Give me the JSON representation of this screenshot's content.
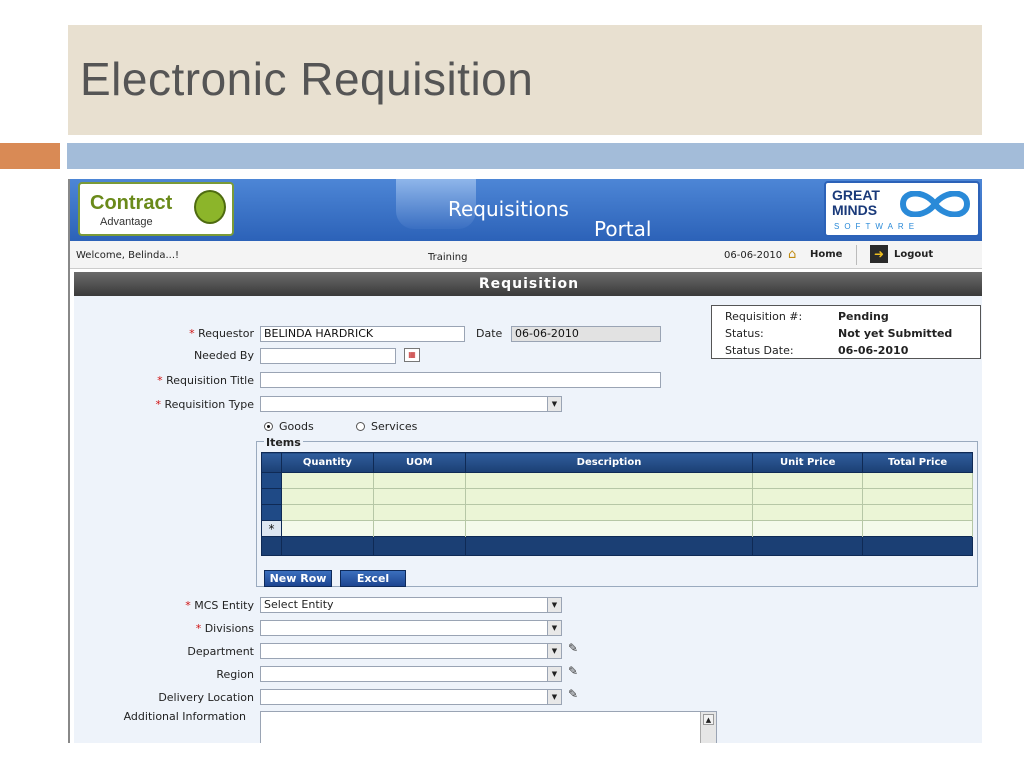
{
  "slide": {
    "title": "Electronic Requisition"
  },
  "banner": {
    "left_logo_main": "Contract",
    "left_logo_sub": "Advantage",
    "portal_word1": "Requisitions",
    "portal_word2": "Portal",
    "right_logo_line1": "GREAT",
    "right_logo_line2": "MINDS",
    "right_logo_line3": "SOFTWARE"
  },
  "infobar": {
    "welcome": "Welcome, Belinda...!",
    "environment": "Training",
    "date": "06-06-2010",
    "home_label": "Home",
    "logout_label": "Logout"
  },
  "section_title": "Requisition",
  "status": {
    "req_no_label": "Requisition #:",
    "req_no_value": "Pending",
    "status_label": "Status:",
    "status_value": "Not yet Submitted",
    "status_date_label": "Status Date:",
    "status_date_value": "06-06-2010"
  },
  "form": {
    "requestor_label": "Requestor",
    "requestor_value": "BELINDA HARDRICK",
    "date_label": "Date",
    "date_value": "06-06-2010",
    "needed_by_label": "Needed By",
    "needed_by_value": "",
    "req_title_label": "Requisition Title",
    "req_title_value": "",
    "req_type_label": "Requisition Type",
    "req_type_value": "",
    "radio_goods": "Goods",
    "radio_services": "Services",
    "items_legend": "Items",
    "items_columns": [
      "Quantity",
      "UOM",
      "Description",
      "Unit Price",
      "Total Price"
    ],
    "new_row_marker": "*",
    "new_row_button": "New Row",
    "excel_button": "Excel",
    "mcs_entity_label": "MCS Entity",
    "mcs_entity_value": "Select Entity",
    "divisions_label": "Divisions",
    "divisions_value": "",
    "department_label": "Department",
    "department_value": "",
    "region_label": "Region",
    "region_value": "",
    "delivery_label": "Delivery Location",
    "delivery_value": "",
    "additional_label": "Additional Information",
    "required_marker": "*"
  }
}
